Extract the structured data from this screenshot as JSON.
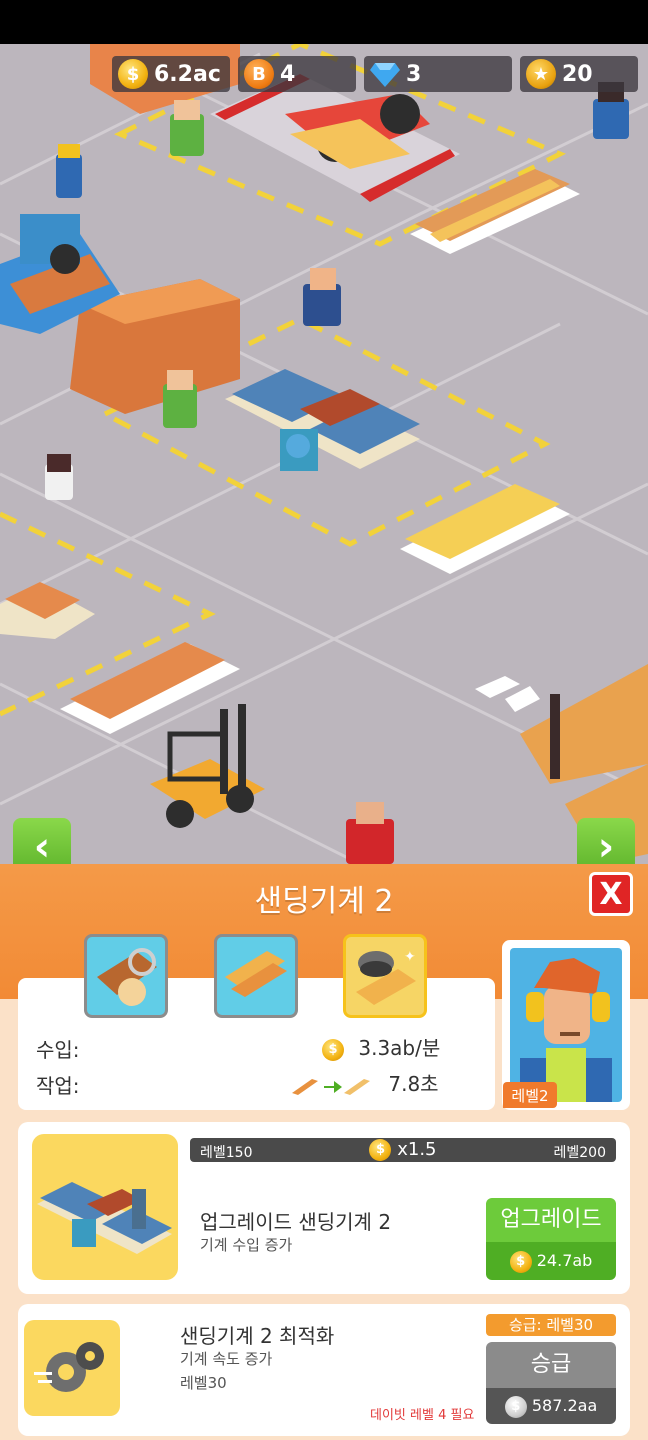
{
  "hud": {
    "coins": "6.2ac",
    "bitcoin": "4",
    "gems": "3",
    "trophies": "20"
  },
  "panel": {
    "title": "샌딩기계 2",
    "close": "X",
    "income_label": "수입:",
    "income_value": "3.3ab/분",
    "work_label": "작업:",
    "work_value": "7.8초",
    "worker_level": "레벨2"
  },
  "upgrade": {
    "progress_left": "레벨150",
    "progress_mid": "x1.5",
    "progress_right": "레벨200",
    "title": "업그레이드 샌딩기계 2",
    "subtitle": "기계 수입 증가",
    "button_label": "업그레이드",
    "button_cost": "24.7ab"
  },
  "optimize": {
    "title": "샌딩기계 2 최적화",
    "subtitle": "기계 속도 증가",
    "level": "레벨30",
    "promo_tag": "승급: 레벨30",
    "button_label": "승급",
    "button_cost": "587.2aa",
    "requirement": "데이빗 레벨 4 필요"
  },
  "icons": {
    "coin": "coin-icon",
    "bitcoin": "bitcoin-icon",
    "gem": "gem-icon",
    "trophy": "trophy-icon",
    "left_arrow": "chevron-left-icon",
    "right_arrow": "chevron-right-icon"
  },
  "colors": {
    "panel_header": "#f28a35",
    "panel_bg": "#fbe1c8",
    "green_button": "#6dcb3b",
    "close_red": "#e02525",
    "floor": "#bcb6bd"
  }
}
